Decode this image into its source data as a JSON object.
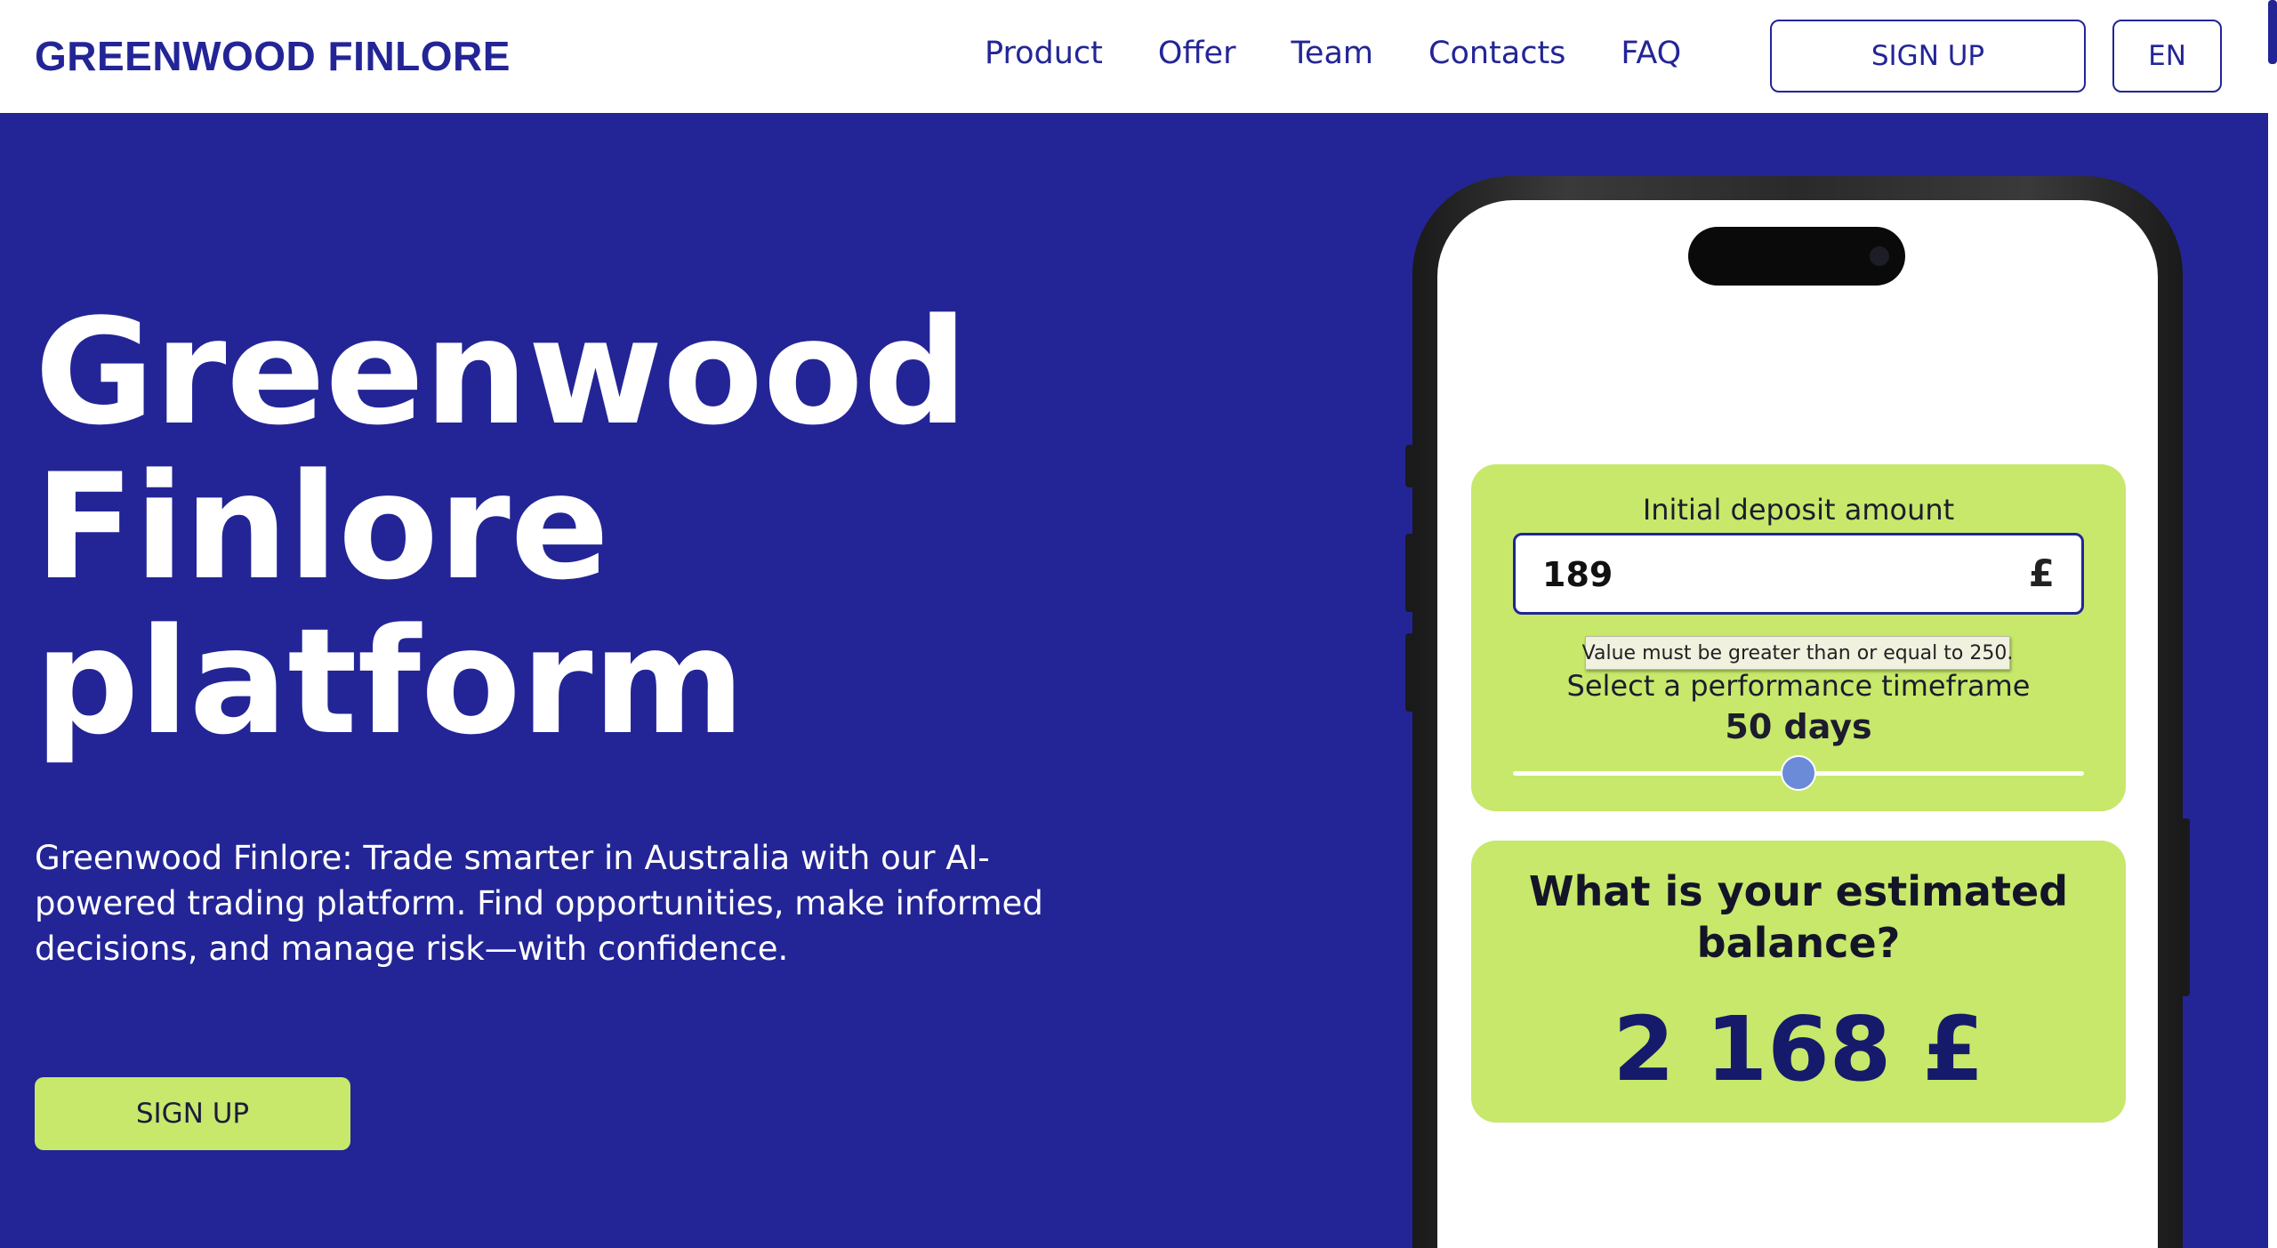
{
  "header": {
    "logo": "GREENWOOD FINLORE",
    "nav": [
      {
        "label": "Product"
      },
      {
        "label": "Offer"
      },
      {
        "label": "Team"
      },
      {
        "label": "Contacts"
      },
      {
        "label": "FAQ"
      }
    ],
    "signup_label": "SIGN UP",
    "lang_label": "EN"
  },
  "hero": {
    "title_lines": [
      "Greenwood",
      "Finlore",
      "platform"
    ],
    "description": "Greenwood Finlore: Trade smarter in Australia with our AI-powered trading platform. Find opportunities, make informed decisions, and manage risk—with confidence.",
    "signup_label": "SIGN UP"
  },
  "calculator": {
    "deposit_label": "Initial deposit amount",
    "deposit_value": "189",
    "currency": "£",
    "validation_message": "Value must be greater than or equal to 250.",
    "timeframe_label": "Select a performance timeframe",
    "timeframe_value": "50 days",
    "slider_fraction": 0.5,
    "balance_question": "What is your estimated balance?",
    "balance_value": "2 168 £"
  },
  "colors": {
    "brand": "#232596",
    "accent": "#c7e86b",
    "slider_thumb": "#6b8bd8"
  }
}
